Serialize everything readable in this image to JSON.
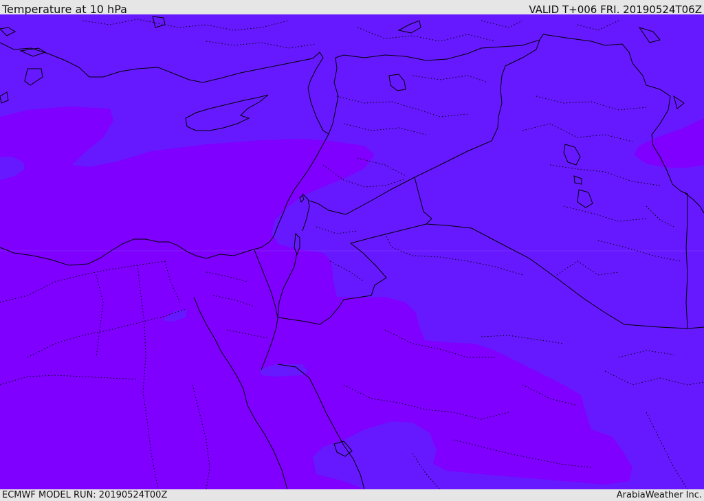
{
  "header": {
    "title": "Temperature at 10 hPa",
    "valid": "VALID T+006 FRI. 20190524T06Z"
  },
  "footer": {
    "model_run": "ECMWF MODEL RUN: 20190524T00Z",
    "credit": "ArabiaWeather Inc."
  },
  "map": {
    "colors": {
      "warmer_field": "#6619ff",
      "colder_field": "#7f00ff",
      "coastline": "#000000",
      "border": "#000000"
    }
  }
}
